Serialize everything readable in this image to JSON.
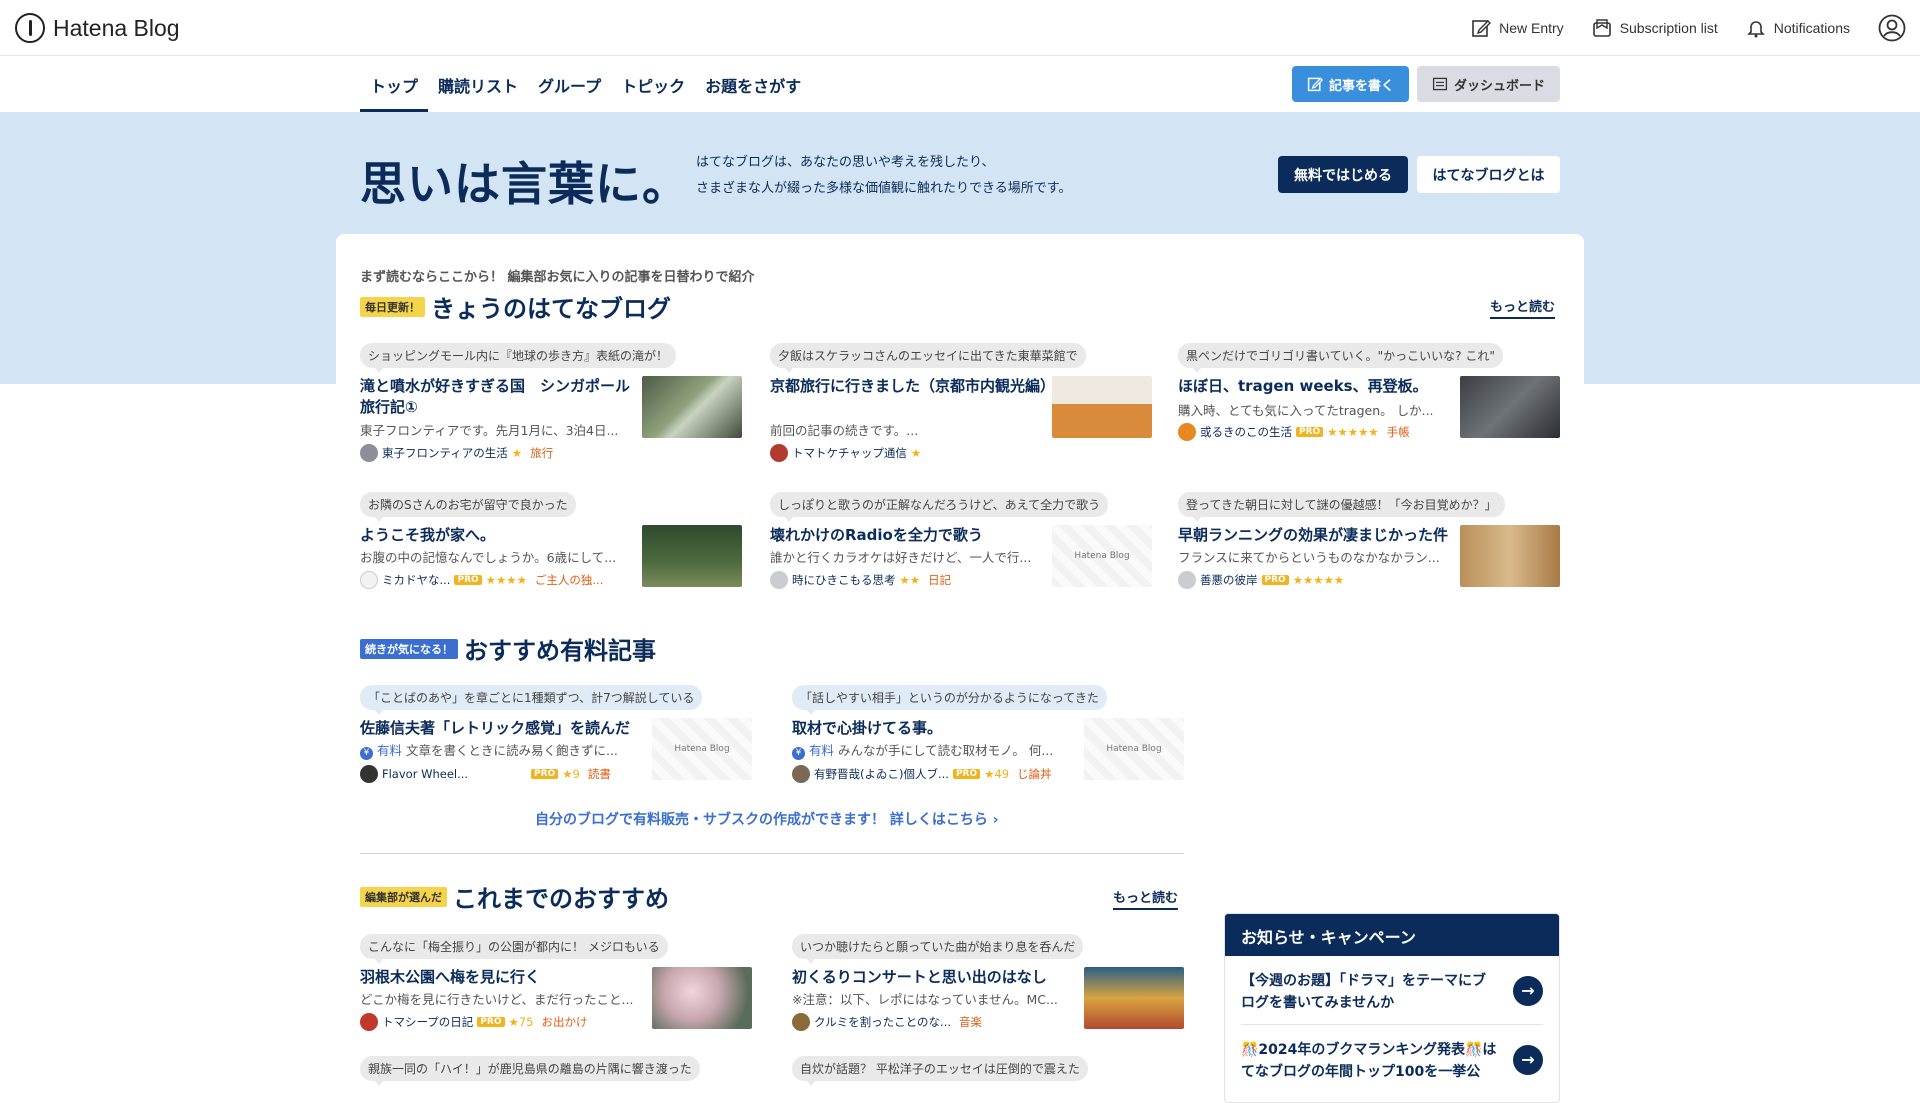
{
  "topbar": {
    "logo_text": "Hatena Blog",
    "new_entry": "New Entry",
    "subscription_list": "Subscription list",
    "notifications": "Notifications"
  },
  "subnav": {
    "tabs": [
      "トップ",
      "購読リスト",
      "グループ",
      "トピック",
      "お題をさがす"
    ],
    "write_button": "記事を書く",
    "dashboard_button": "ダッシュボード"
  },
  "hero": {
    "title": "思いは言葉に。",
    "desc_line1": "はてなブログは、あなたの思いや考えを残したり、",
    "desc_line2": "さまざまな人が綴った多様な価値観に触れたりできる場所です。",
    "start_button": "無料ではじめる",
    "about_button": "はてなブログとは"
  },
  "today": {
    "eyebrow": "まず読むならここから！ 編集部お気に入りの記事を日替わりで紹介",
    "badge": "毎日更新！",
    "title": "きょうのはてなブログ",
    "more": "もっと読む",
    "items": [
      {
        "bubble": "ショッピングモール内に『地球の歩き方』表紙の滝が！",
        "title": "滝と噴水が好きすぎる国　シンガポール旅行記①",
        "excerpt": "東子フロンティアです。先月1月に、3泊4日...",
        "blog": "東子フロンティアの生活",
        "stars": "★",
        "category": "旅行",
        "pro": ""
      },
      {
        "bubble": "夕飯はスケラッコさんのエッセイに出てきた東華菜館で",
        "title": "京都旅行に行きました（京都市内観光編）",
        "excerpt": "前回の記事の続きです。...",
        "blog": "トマトケチャップ通信",
        "stars": "★",
        "category": "",
        "pro": ""
      },
      {
        "bubble": "黒ペンだけでゴリゴリ書いていく。\"かっこいいな? これ\"",
        "title": "ほぼ日、tragen weeks、再登板。",
        "excerpt": "購入時、とても気に入ってたtragen。 しか...",
        "blog": "或るきのこの生活",
        "stars": "★★★★★",
        "category": "手帳",
        "pro": "PRO"
      },
      {
        "bubble": "お隣のSさんのお宅が留守で良かった",
        "title": "ようこそ我が家へ。",
        "excerpt": "お腹の中の記憶なんでしょうか。6歳にして...",
        "blog": "ミカドヤな...",
        "stars": "★★★★",
        "category": "ご主人の独...",
        "pro": "PRO"
      },
      {
        "bubble": "しっぽりと歌うのが正解なんだろうけど、あえて全力で歌う",
        "title": "壊れかけのRadioを全力で歌う",
        "excerpt": "誰かと行くカラオケは好きだけど、一人で行...",
        "blog": "時にひきこもる思考",
        "stars": "★★",
        "category": "日記",
        "pro": ""
      },
      {
        "bubble": "登ってきた朝日に対して謎の優越感！「今お目覚めか？」",
        "title": "早朝ランニングの効果が凄まじかった件",
        "excerpt": "フランスに来てからというものなかなかラン...",
        "blog": "善悪の彼岸",
        "stars": "★★★★★",
        "category": "",
        "pro": "PRO"
      }
    ]
  },
  "paid": {
    "badge": "続きが気になる！",
    "title": "おすすめ有料記事",
    "items": [
      {
        "bubble": "「ことばのあや」を章ごとに1種類ずつ、計7つ解説している",
        "title": "佐藤信夫著「レトリック感覚」を読んだ",
        "paid_label": "有料",
        "excerpt": "文章を書くときに読み易く飽きずに...",
        "blog": "Flavor Wheel...",
        "stars": "★9",
        "category": "読書",
        "pro": "PRO"
      },
      {
        "bubble": "「話しやすい相手」というのが分かるようになってきた",
        "title": "取材で心掛けてる事。",
        "paid_label": "有料",
        "excerpt": "みんなが手にして読む取材モノ。 何...",
        "blog": "有野晋哉(よゐこ)個人ブ...",
        "stars": "★49",
        "category": "じ論丼",
        "pro": "PRO"
      }
    ],
    "link": "自分のブログで有料販売・サブスクの作成ができます！ 詳しくはこちら"
  },
  "recommend": {
    "badge": "編集部が選んだ",
    "title": "これまでのおすすめ",
    "more": "もっと読む",
    "items": [
      {
        "bubble": "こんなに「梅全振り」の公園が都内に！ メジロもいる",
        "title": "羽根木公園へ梅を見に行く",
        "excerpt": "どこか梅を見に行きたいけど、まだ行ったこと...",
        "blog": "トマシープの日記",
        "stars": "★75",
        "category": "お出かけ",
        "pro": "PRO"
      },
      {
        "bubble": "いつか聴けたらと願っていた曲が始まり息を呑んだ",
        "title": "初くるりコンサートと思い出のはなし",
        "excerpt": "※注意：以下、レポにはなっていません。MC...",
        "blog": "クルミを割ったことのな...",
        "stars": "",
        "category": "音楽",
        "pro": ""
      },
      {
        "bubble": "親族一同の「ハイ！」が鹿児島県の離島の片隅に響き渡った",
        "title": "",
        "excerpt": "",
        "blog": "",
        "stars": "",
        "category": "",
        "pro": ""
      },
      {
        "bubble": "自炊が話題？ 平松洋子のエッセイは圧倒的で震えた",
        "title": "",
        "excerpt": "",
        "blog": "",
        "stars": "",
        "category": "",
        "pro": ""
      }
    ]
  },
  "news": {
    "title": "お知らせ・キャンペーン",
    "items": [
      "【今週のお題】「ドラマ」をテーマにブログを書いてみませんか",
      "🎊2024年のブクマランキング発表🎊はてなブログの年間トップ100を一挙公"
    ]
  },
  "thumb_placeholder_text": "Hatena Blog"
}
